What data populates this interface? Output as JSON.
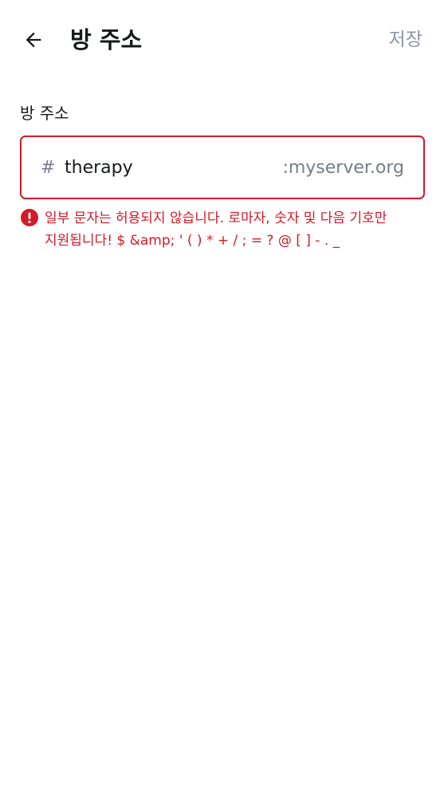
{
  "header": {
    "title": "방 주소",
    "save_label": "저장",
    "back_icon": "arrow-left-icon"
  },
  "form": {
    "label": "방 주소",
    "prefix": "#",
    "value": "therapy",
    "suffix": ":myserver.org",
    "error_icon": "exclamation-circle-icon",
    "error_message": "일부 문자는 허용되지 않습니다. 로마자, 숫자 및 다음 기호만 지원됩니다! $ &amp; ' ( ) * + / ; = ? @ [ ] - . _"
  },
  "colors": {
    "error": "#d51928",
    "text_primary": "#17191c",
    "text_secondary": "#737d8c",
    "disabled_action": "#8d97a5"
  }
}
